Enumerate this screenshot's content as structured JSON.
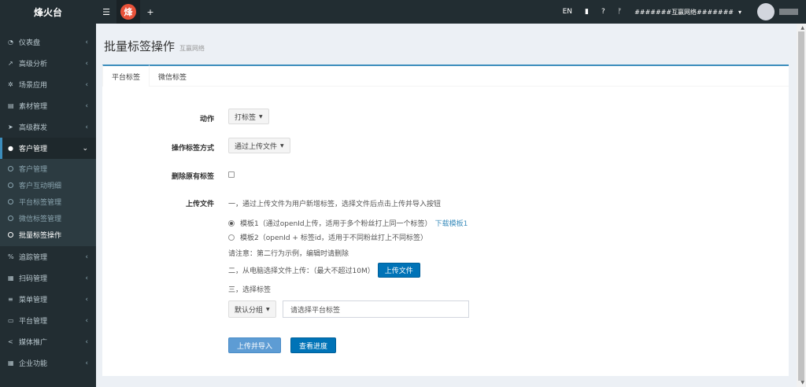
{
  "header": {
    "logo": "烽火台",
    "menu_icon": "☰",
    "tab_logo_char": "烽",
    "add_icon": "+",
    "lang": "EN",
    "book_icon": "▮",
    "help_icon": "?",
    "branch_icon": "ᚠ",
    "org_name": "#######互赢网络#######",
    "org_caret": "▾"
  },
  "sidebar": {
    "items": [
      {
        "icon": "◔",
        "label": "仪表盘",
        "chev": "‹"
      },
      {
        "icon": "↗",
        "label": "高级分析",
        "chev": "‹"
      },
      {
        "icon": "✲",
        "label": "场景应用",
        "chev": "‹"
      },
      {
        "icon": "▤",
        "label": "素材管理",
        "chev": "‹"
      },
      {
        "icon": "➤",
        "label": "高级群发",
        "chev": "‹"
      }
    ],
    "active": {
      "icon": "●",
      "label": "客户管理",
      "chev": "⌄"
    },
    "sub_items": [
      "客户管理",
      "客户互动明细",
      "平台标签管理",
      "微信标签管理",
      "批量标签操作"
    ],
    "items_bottom": [
      {
        "icon": "%",
        "label": "追踪管理",
        "chev": "‹"
      },
      {
        "icon": "▦",
        "label": "扫码管理",
        "chev": "‹"
      },
      {
        "icon": "≡",
        "label": "菜单管理",
        "chev": "‹"
      },
      {
        "icon": "▭",
        "label": "平台管理",
        "chev": "‹"
      },
      {
        "icon": "<",
        "label": "媒体推广",
        "chev": "‹"
      },
      {
        "icon": "▦",
        "label": "企业功能",
        "chev": "‹"
      }
    ]
  },
  "page": {
    "title": "批量标签操作",
    "subtitle": "互赢网络"
  },
  "tabs": [
    "平台标签",
    "微信标签"
  ],
  "form": {
    "action_label": "动作",
    "action_value": "打标签",
    "method_label": "操作标签方式",
    "method_value": "通过上传文件",
    "delete_label": "删除原有标签",
    "upload_label": "上传文件",
    "step1": "一，通过上传文件为用户新增标签，选择文件后点击上传并导入按钮",
    "template1": "模板1（通过openId上传，适用于多个粉丝打上同一个标签）",
    "download_template1": "下载模板1",
    "template2": "模板2（openId + 标签id，适用于不同粉丝打上不同标签）",
    "note": "请注意：第二行为示例，编辑时请删除",
    "step2": "二，从电脑选择文件上传：（最大不超过10M）",
    "upload_button": "上传文件",
    "step3": "三，选择标签",
    "group_value": "默认分组",
    "tag_placeholder": "请选择平台标签",
    "submit_button": "上传并导入",
    "progress_button": "查看进度"
  },
  "colors": {
    "sidebar_bg": "#222d32",
    "accent": "#3c8dbc",
    "button_blue": "#0073b7"
  }
}
